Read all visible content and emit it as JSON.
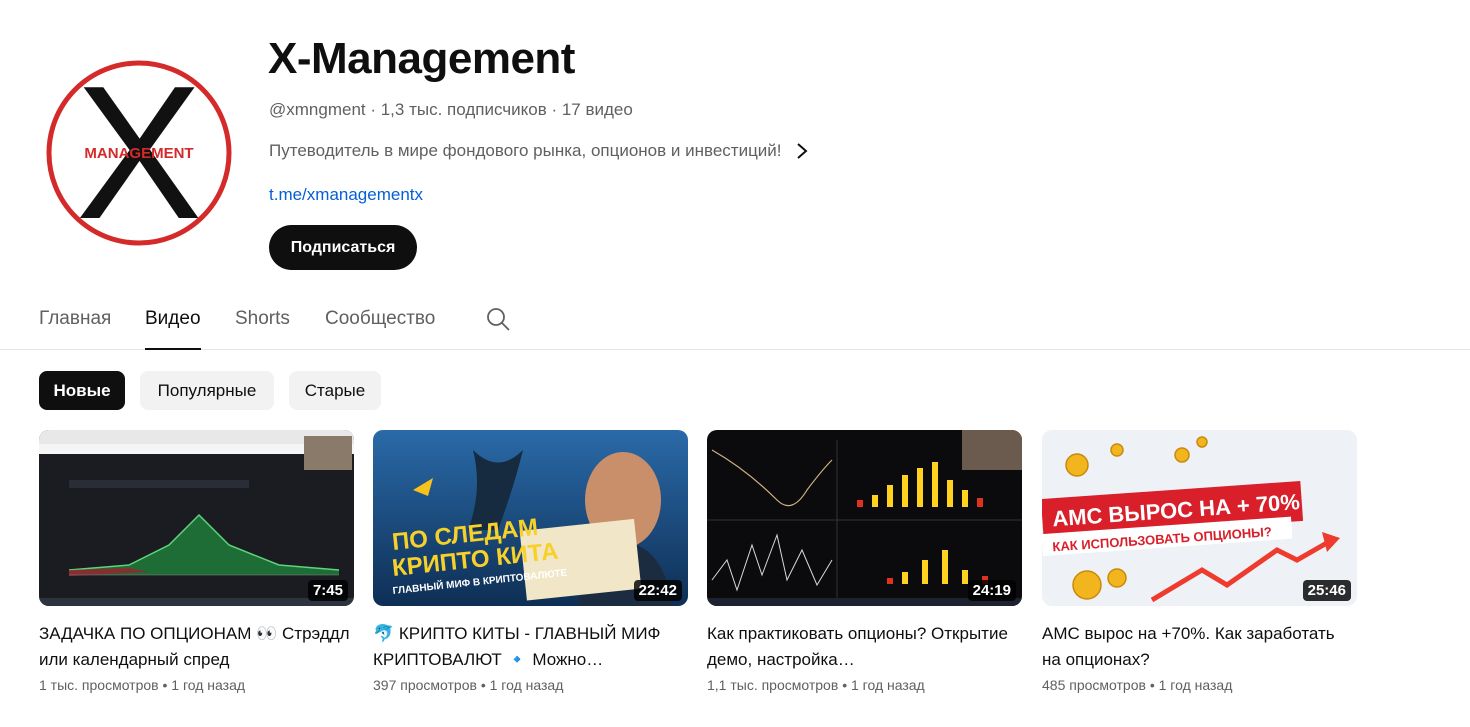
{
  "channel": {
    "title": "X-Management",
    "logo_text": "MANAGEMENT",
    "logo_letter": "X",
    "meta": "@xmngment · 1,3 тыс. подписчиков · 17 видео",
    "description": "Путеводитель в мире фондового рынка, опционов и инвестиций!",
    "link": "t.me/xmanagementx",
    "subscribe_label": "Подписаться"
  },
  "tabs": [
    {
      "label": "Главная",
      "active": false
    },
    {
      "label": "Видео",
      "active": true
    },
    {
      "label": "Shorts",
      "active": false
    },
    {
      "label": "Сообщество",
      "active": false
    }
  ],
  "chips": [
    {
      "label": "Новые",
      "active": true
    },
    {
      "label": "Популярные",
      "active": false
    },
    {
      "label": "Старые",
      "active": false
    }
  ],
  "videos": [
    {
      "title": "ЗАДАЧКА ПО ОПЦИОНАМ 👀 Стрэддл или календарный спред",
      "views": "1 тыс. просмотров",
      "age": "1 год назад",
      "duration": "7:45"
    },
    {
      "title": "🐬 КРИПТО КИТЫ - ГЛАВНЫЙ МИФ КРИПТОВАЛЮТ 🔹 Можно…",
      "views": "397 просмотров",
      "age": "1 год назад",
      "duration": "22:42",
      "thumb_text_1": "ПО СЛЕДАМ",
      "thumb_text_2": "КРИПТО КИТА",
      "thumb_text_3": "ГЛАВНЫЙ МИФ В КРИПТОВАЛЮТЕ"
    },
    {
      "title": "Как практиковать опционы? Открытие демо, настройка…",
      "views": "1,1 тыс. просмотров",
      "age": "1 год назад",
      "duration": "24:19"
    },
    {
      "title": "AMC вырос на +70%. Как заработать на опционах?",
      "views": "485 просмотров",
      "age": "1 год назад",
      "duration": "25:46",
      "thumb_text_1": "AMC ВЫРОС НА + 70%",
      "thumb_text_2": "КАК ИСПОЛЬЗОВАТЬ ОПЦИОНЫ?"
    }
  ],
  "meta_separator": "•",
  "colors": {
    "accent": "#0f0f0f",
    "link": "#065fd4",
    "logo_red": "#d42a2a",
    "chip_bg": "#f2f2f2"
  }
}
